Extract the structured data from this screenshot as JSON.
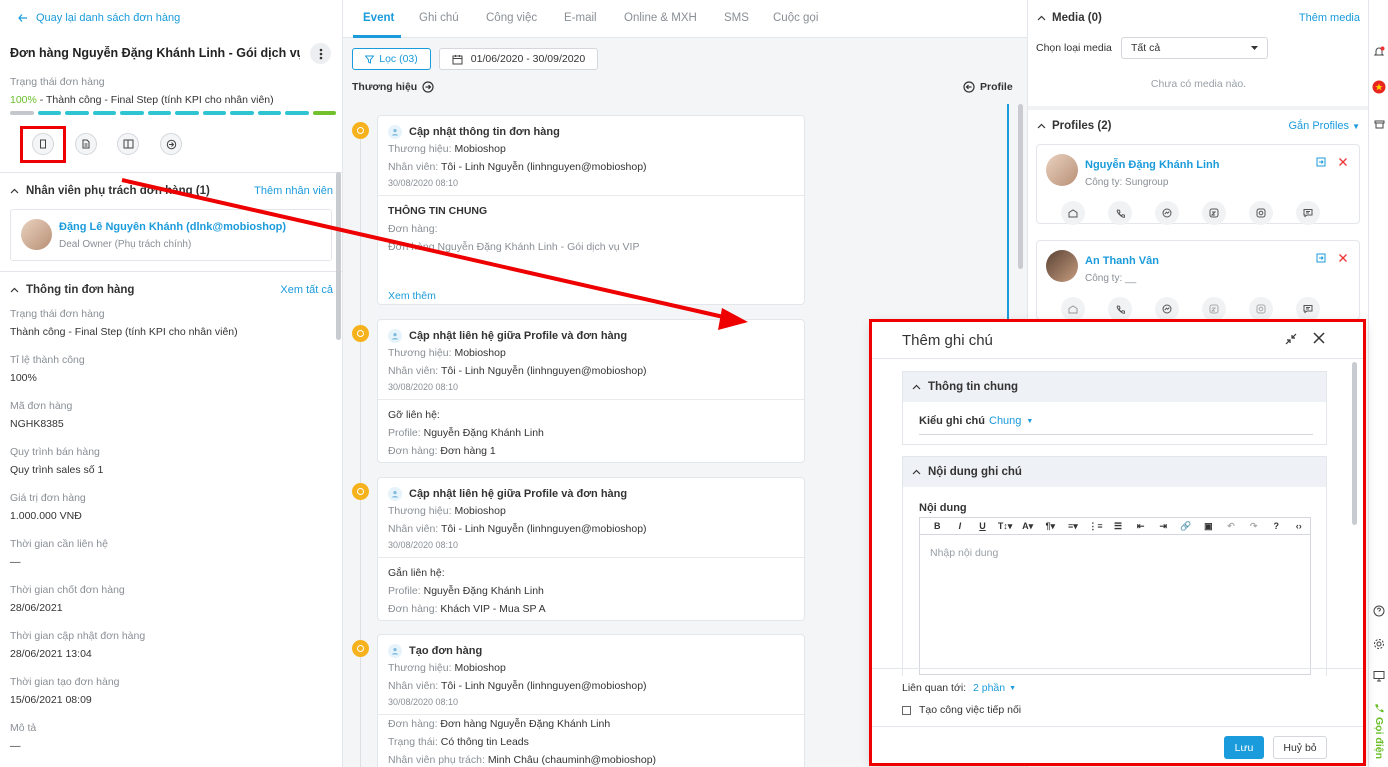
{
  "left": {
    "back_label": "Quay lại danh sách đơn hàng",
    "deal_title": "Đơn hàng Nguyễn Đặng Khánh Linh - Gói dịch vụ VIP...",
    "stage_label": "Trạng thái đơn hàng",
    "stage_pct": "100%",
    "stage_text": " - Thành công - Final Step (tính KPI cho nhân viên)",
    "owner_section": {
      "title": "Nhân viên phụ trách đơn hàng (1)",
      "action": "Thêm nhân viên"
    },
    "owner": {
      "name": "Đặng Lê Nguyên Khánh (dlnk@mobioshop)",
      "role": "Deal Owner (Phụ trách chính)"
    },
    "info_section": {
      "title": "Thông tin đơn hàng",
      "action": "Xem tất cả"
    },
    "info_items": [
      {
        "label": "Trạng thái đơn hàng",
        "value": "Thành công - Final Step (tính KPI cho nhân viên)"
      },
      {
        "label": "Tỉ lệ thành công",
        "value": "100%"
      },
      {
        "label": "Mã đơn hàng",
        "value": "NGHK8385"
      },
      {
        "label": "Quy trình bán hàng",
        "value": "Quy trình sales số 1"
      },
      {
        "label": "Giá trị đơn hàng",
        "value": "1.000.000 VNĐ"
      },
      {
        "label": "Thời gian cần liên hệ",
        "value": "—"
      },
      {
        "label": "Thời gian chốt đơn hàng",
        "value": "28/06/2021"
      },
      {
        "label": "Thời gian cập nhật đơn hàng",
        "value": "28/06/2021 13:04"
      },
      {
        "label": "Thời gian tạo đơn hàng",
        "value": "15/06/2021 08:09"
      },
      {
        "label": "Mô tả",
        "value": "—"
      }
    ]
  },
  "mid": {
    "tabs": [
      "Event",
      "Ghi chú",
      "Công việc",
      "E-mail",
      "Online & MXH",
      "SMS",
      "Cuộc gọi"
    ],
    "filter_label": "Lọc (03)",
    "date_range": "01/06/2020 - 30/09/2020",
    "brand_head": "Thương hiệu",
    "profile_head": "Profile",
    "cards": [
      {
        "title": "Cập nhật thông tin đơn hàng",
        "brand_k": "Thương hiệu: ",
        "brand_v": "Mobioshop",
        "staff_k": "Nhân viên: ",
        "staff_v": "Tôi - Linh Nguyễn (linhnguyen@mobioshop)",
        "time": "30/08/2020 08:10",
        "body_title": "THÔNG TIN CHUNG",
        "body_l1": "Đơn hàng:",
        "body_l2": "Đơn hàng Nguyễn Đặng Khánh Linh - Gói dịch vụ VIP",
        "more": "Xem thêm"
      },
      {
        "title": "Cập nhật liên hệ giữa Profile và đơn hàng",
        "brand_k": "Thương hiệu: ",
        "brand_v": "Mobioshop",
        "staff_k": "Nhân viên: ",
        "staff_v": "Tôi - Linh Nguyễn (linhnguyen@mobioshop)",
        "time": "30/08/2020 08:10",
        "body_title": "Gỡ liên hệ:",
        "r1_k": "Profile: ",
        "r1_v": "Nguyễn Đặng Khánh Linh",
        "r2_k": "Đơn hàng: ",
        "r2_v": "Đơn hàng 1"
      },
      {
        "title": "Cập nhật liên hệ giữa Profile và đơn hàng",
        "brand_k": "Thương hiệu: ",
        "brand_v": "Mobioshop",
        "staff_k": "Nhân viên: ",
        "staff_v": "Tôi - Linh Nguyễn (linhnguyen@mobioshop)",
        "time": "30/08/2020 08:10",
        "body_title": "Gắn liên hệ:",
        "r1_k": "Profile: ",
        "r1_v": "Nguyễn Đặng Khánh Linh",
        "r2_k": "Đơn hàng: ",
        "r2_v": "Khách VIP - Mua SP A"
      },
      {
        "title": "Tạo đơn hàng",
        "brand_k": "Thương hiệu: ",
        "brand_v": "Mobioshop",
        "staff_k": "Nhân viên: ",
        "staff_v": "Tôi - Linh Nguyễn (linhnguyen@mobioshop)",
        "time": "30/08/2020 08:10",
        "r1_k": "Đơn hàng: ",
        "r1_v": "Đơn hàng Nguyễn Đặng Khánh Linh",
        "r2_k": "Trạng thái: ",
        "r2_v": "Có thông tin Leads",
        "r3_k": "Nhân viên phụ trách: ",
        "r3_v": "Minh Châu (chauminh@mobioshop)"
      }
    ]
  },
  "right": {
    "media": {
      "title": "Media (0)",
      "action": "Thêm media",
      "select_label": "Chọn loại media",
      "select_value": "Tất cả",
      "empty": "Chưa có media nào."
    },
    "profiles": {
      "title": "Profiles (2)",
      "action": "Gắn Profiles",
      "items": [
        {
          "name": "Nguyễn Đặng Khánh Linh",
          "company": "Công ty: Sungroup"
        },
        {
          "name": "An Thanh Vân",
          "company": "Công ty: __"
        }
      ]
    }
  },
  "rail": {
    "call_label": "Gọi điện"
  },
  "modal": {
    "title": "Thêm ghi chú",
    "general_section": "Thông tin chung",
    "note_type_label": "Kiểu ghi chú",
    "note_type_value": "Chung",
    "content_section": "Nội dung ghi chú",
    "content_label": "Nội dung",
    "toolbar": [
      "B",
      "I",
      "U",
      "T↕▾",
      "A▾",
      "¶▾",
      "≡▾",
      "⋮≡",
      "☰",
      "⇤",
      "⇥",
      "🔗",
      "▣",
      "↶",
      "↷",
      "?",
      "‹›"
    ],
    "placeholder": "Nhập nội dung",
    "related_label": "Liên quan tới:",
    "related_value": "2 phần",
    "followup_label": "Tạo công việc tiếp nối",
    "save_label": "Lưu",
    "cancel_label": "Huỷ bỏ"
  },
  "colors": {
    "accent": "#1a9bdb",
    "success": "#6bbf2a",
    "highlight": "#e00000",
    "timeline_dot": "#f6b21c"
  }
}
